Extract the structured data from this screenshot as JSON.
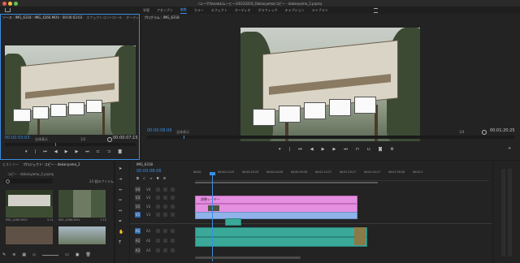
{
  "window": {
    "title": "/ユーザ/tanaka/ムービー/20210316_Oakanyama/コピー - dakanyama_2.prproj"
  },
  "colors": {
    "accent": "#3b8de0",
    "playhead": "#3b8de0",
    "clip_adjustment": "#e58fe0",
    "clip_audio": "#3aa99a",
    "clip_video": "#8fb3e8"
  },
  "workspaces": [
    "学習",
    "アセンブリ",
    "編集",
    "カラー",
    "エフェクト",
    "オーディオ",
    "グラフィック",
    "キャプション",
    "ライブラリ"
  ],
  "source_monitor": {
    "tabs": [
      "ソース : IMG_6318 : IMG_4266.MOV : 00:00:03:03",
      "エフェクトコントロール",
      "オーディ"
    ],
    "timecode": "00:00:03:03",
    "fit": "全体表示",
    "resolution": "1/2",
    "duration": "00:00:07:15"
  },
  "program_monitor": {
    "tab": "プログラム : IMG_6318",
    "timecode": "00:00:08:06",
    "fit": "全体表示",
    "resolution": "1/4",
    "duration": "00:01:20:25"
  },
  "project_panel": {
    "tabs": [
      "ヒストリー",
      "プロジェクト: コピー - dakanyama_2"
    ],
    "path": "コピー - dakanyama_2.prproj",
    "count": "24 個のアイテム",
    "items": [
      {
        "name": "IMG_4265.MOV",
        "duration": "5:11"
      },
      {
        "name": "IMG_4266.MOV",
        "duration": "7:15"
      }
    ]
  },
  "timeline": {
    "sequence": "IMG_6318",
    "timecode": "00:00:08:06",
    "ruler": [
      "00:00",
      "00:00:14:29",
      "00:00:29:29",
      "00:00:44:28",
      "00:00:59:28",
      "00:01:14:27",
      "00:01:29:27",
      "00:01:44:27",
      "00:01:59:26",
      "00:02:1"
    ],
    "tracks": [
      "V4",
      "V3",
      "V2",
      "V1",
      "A1",
      "A2",
      "A3"
    ],
    "adjustment_label": "調整レイヤー"
  }
}
